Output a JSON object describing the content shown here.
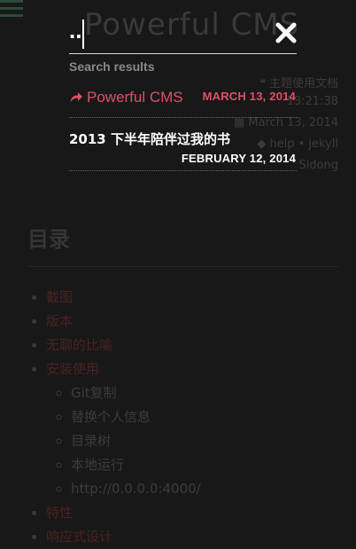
{
  "search": {
    "query": "..",
    "results_label": "Search results",
    "results": [
      {
        "title": "Powerful CMS",
        "date": "MARCH 13, 2014"
      },
      {
        "title": "2013 下半年陪伴过我的书",
        "date": "FEBRUARY 12, 2014"
      }
    ]
  },
  "background": {
    "site_title": "Powerful CMS",
    "meta": {
      "category": "主题使用文档",
      "time": "13:21:38",
      "date": "March 13, 2014",
      "tags": "help • jekyll",
      "author": "Sidong"
    },
    "toc_title": "目录",
    "toc": [
      {
        "label": "截图"
      },
      {
        "label": "版本"
      },
      {
        "label": "无聊的比喻"
      },
      {
        "label": "安装使用",
        "children": [
          "Git复制",
          "替换个人信息",
          "目录树",
          "本地运行",
          "http://0.0.0.0:4000/"
        ]
      },
      {
        "label": "特性"
      },
      {
        "label": "响应式设计"
      }
    ]
  },
  "colors": {
    "overlay_bg": "#181818",
    "accent": "#e0506a",
    "text_primary": "#ffffff",
    "text_muted": "#8a8a8a"
  }
}
